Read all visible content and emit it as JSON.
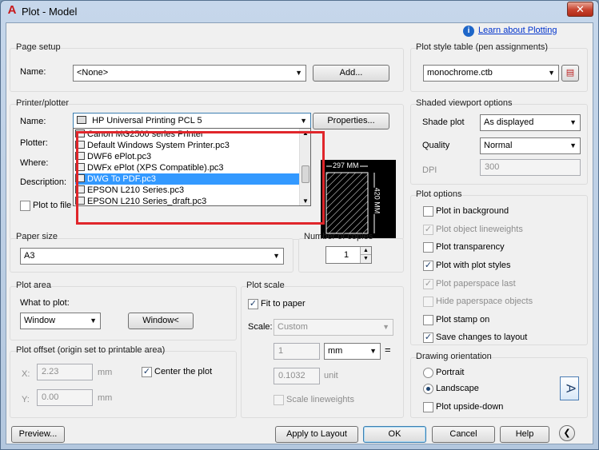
{
  "window": {
    "title": "Plot - Model",
    "close": "✕"
  },
  "help_link": "Learn about Plotting",
  "page_setup": {
    "group": "Page setup",
    "name_label": "Name:",
    "name_value": "<None>",
    "add_button": "Add..."
  },
  "plot_style": {
    "group": "Plot style table (pen assignments)",
    "value": "monochrome.ctb"
  },
  "printer": {
    "group": "Printer/plotter",
    "name_label": "Name:",
    "name_value": "HP Universal Printing PCL 5",
    "properties_button": "Properties...",
    "plotter_label": "Plotter:",
    "where_label": "Where:",
    "description_label": "Description:",
    "plot_to_file_label": "Plot to file",
    "plot_to_file": false,
    "paper_width": "297 MM",
    "paper_height": "420 MM",
    "dropdown_items": [
      "Canon MG2500 series Printer",
      "Default Windows System Printer.pc3",
      "DWF6 ePlot.pc3",
      "DWFx ePlot (XPS Compatible).pc3",
      "DWG To PDF.pc3",
      "EPSON L210 Series.pc3",
      "EPSON L210 Series_draft.pc3"
    ],
    "selected_item": "DWG To PDF.pc3"
  },
  "shaded": {
    "group": "Shaded viewport options",
    "shade_plot_label": "Shade plot",
    "shade_plot_value": "As displayed",
    "quality_label": "Quality",
    "quality_value": "Normal",
    "dpi_label": "DPI",
    "dpi_value": "300"
  },
  "plot_options": {
    "group": "Plot options",
    "items": [
      {
        "label": "Plot in background",
        "checked": false,
        "disabled": false
      },
      {
        "label": "Plot object lineweights",
        "checked": true,
        "disabled": true
      },
      {
        "label": "Plot transparency",
        "checked": false,
        "disabled": false
      },
      {
        "label": "Plot with plot styles",
        "checked": true,
        "disabled": false
      },
      {
        "label": "Plot paperspace last",
        "checked": true,
        "disabled": true
      },
      {
        "label": "Hide paperspace objects",
        "checked": false,
        "disabled": true
      },
      {
        "label": "Plot stamp on",
        "checked": false,
        "disabled": false
      },
      {
        "label": "Save changes to layout",
        "checked": true,
        "disabled": false
      }
    ]
  },
  "paper_size": {
    "group": "Paper size",
    "value": "A3"
  },
  "copies": {
    "group": "Number of copies",
    "value": "1"
  },
  "plot_area": {
    "group": "Plot area",
    "what_label": "What to plot:",
    "value": "Window",
    "window_button": "Window<"
  },
  "plot_scale": {
    "group": "Plot scale",
    "fit_label": "Fit to paper",
    "fit_checked": true,
    "scale_label": "Scale:",
    "scale_value": "Custom",
    "value1": "1",
    "unit_value": "mm",
    "equals": "=",
    "value2": "0.1032",
    "unit_label": "unit",
    "scale_lw_label": "Scale lineweights"
  },
  "plot_offset": {
    "group": "Plot offset (origin set to printable area)",
    "x_label": "X:",
    "x_value": "2.23",
    "y_label": "Y:",
    "y_value": "0.00",
    "unit": "mm",
    "center_label": "Center the plot",
    "center_checked": true
  },
  "orientation": {
    "group": "Drawing orientation",
    "portrait": "Portrait",
    "landscape": "Landscape",
    "selected": "Landscape",
    "upside_down": "Plot upside-down",
    "icon_letter": "A"
  },
  "footer": {
    "preview": "Preview...",
    "apply": "Apply to Layout",
    "ok": "OK",
    "cancel": "Cancel",
    "help": "Help"
  }
}
